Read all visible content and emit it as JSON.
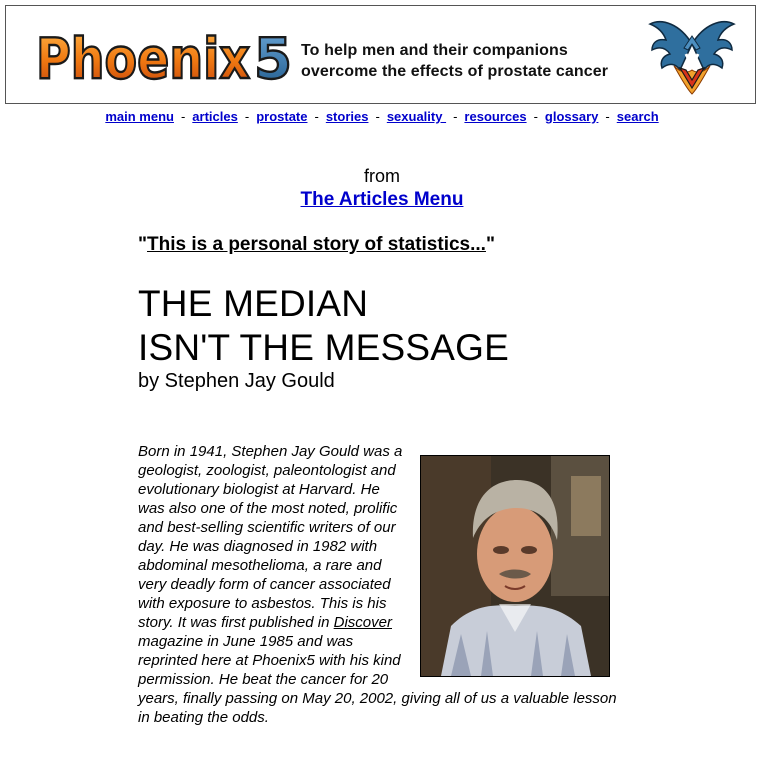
{
  "header": {
    "logo_text": "Phoenix5",
    "tagline_line1": "To help men and their companions",
    "tagline_line2": "overcome the effects of prostate cancer",
    "logo_colors": {
      "phoenix": "#e8730c",
      "five": "#2a6fa8",
      "outline": "#1a1a1a"
    }
  },
  "nav": {
    "items": [
      {
        "label": "main menu"
      },
      {
        "label": "articles"
      },
      {
        "label": "prostate"
      },
      {
        "label": "stories"
      },
      {
        "label": "sexuality "
      },
      {
        "label": "resources"
      },
      {
        "label": "glossary"
      },
      {
        "label": "search"
      }
    ],
    "separator": "-"
  },
  "content": {
    "from_text": "from",
    "articles_menu_link": "The Articles Menu",
    "quote_open": "\"",
    "quote_text": "This is a personal story of statistics...",
    "quote_close": "\"",
    "title_line1": "THE MEDIAN",
    "title_line2": "ISN'T THE MESSAGE",
    "byline": "by Stephen Jay Gould",
    "bio_part1": "Born in 1941, Stephen Jay Gould was a geologist, zoologist, paleontologist and evolutionary biologist at Harvard. He was also one of the most noted, prolific and best-selling scientific writers of our day. He was diagnosed in 1982 with abdominal mesothelioma, a rare and very deadly form of cancer associated with exposure to asbestos. This is his story. It was first published in ",
    "bio_link": "Discover",
    "bio_part2": " magazine in June 1985 and was reprinted here at Phoenix5 with his kind permission. He beat the cancer for 20 years, finally passing on May 20, 2002, giving all of us a valuable lesson in beating the odds."
  },
  "colors": {
    "link": "#0000cc",
    "text": "#000000"
  }
}
